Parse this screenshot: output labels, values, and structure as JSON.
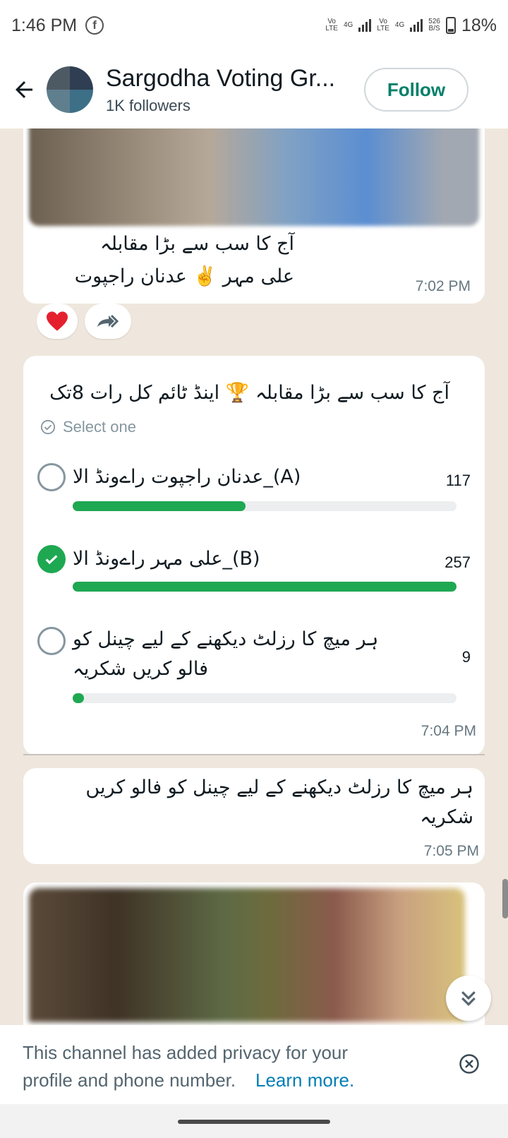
{
  "status_bar": {
    "time": "1:46 PM",
    "app_icon": "facebook-icon",
    "sim1_top": "Vo",
    "sim1_bottom": "LTE",
    "sim1_net": "4G",
    "sim2_top": "Vo",
    "sim2_bottom": "LTE",
    "sim2_net": "4G",
    "speed_top": "526",
    "speed_bottom": "B/S",
    "battery": "18%"
  },
  "header": {
    "back_icon": "arrow-left-icon",
    "title": "Sargodha Voting Gr...",
    "followers": "1K followers",
    "follow_label": "Follow",
    "accent_color": "#008069"
  },
  "messages": [
    {
      "line1": "آج کا سب سے بڑا مقابلہ",
      "line2": "علی مہر ✌️ عدنان راجپوت",
      "time": "7:02 PM",
      "reactions": [
        "heart-reaction",
        "forward-icon"
      ]
    }
  ],
  "poll": {
    "question": "آج کا سب سے بڑا مقابلہ 🏆 اینڈ ٹائم کل رات 8تک",
    "select_label": "Select one",
    "bar_color": "#1ea852",
    "options": [
      {
        "label": "(A)_عدنان  راجپوت  راےونڈ  الا",
        "count": "117",
        "fraction": 0.45,
        "checked": false
      },
      {
        "label": "(B)_علی  مہر  راےونڈ  الا",
        "count": "257",
        "fraction": 1.0,
        "checked": true
      },
      {
        "label_line1": "ہر میچ کا رزلٹ دیکھنے کے لیے چینل کو",
        "label_line2": "فالو کریں شکریہ",
        "count": "9",
        "fraction": 0.03,
        "checked": false
      }
    ],
    "time": "7:04 PM"
  },
  "text_message": {
    "line1": "ہر میچ کا رزلٹ دیکھنے کے لیے چینل کو فالو کریں",
    "line2": "شکریہ",
    "time": "7:05 PM"
  },
  "privacy": {
    "text": "This channel has added privacy for your profile and phone number.",
    "link": "Learn more.",
    "link_color": "#027eb5"
  }
}
